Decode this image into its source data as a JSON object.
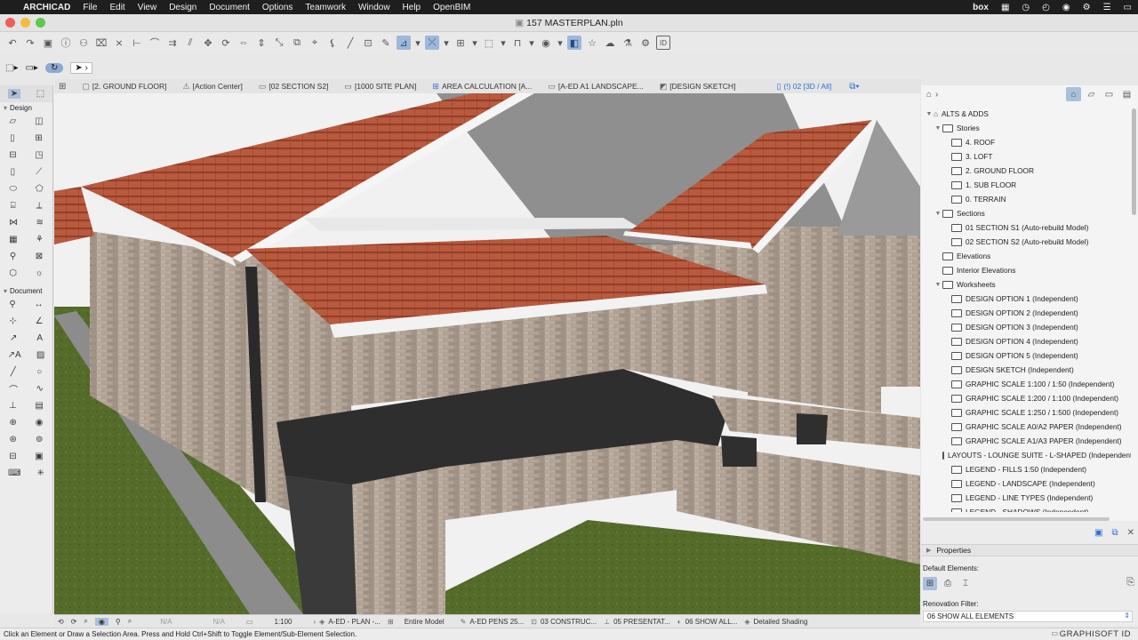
{
  "menubar": {
    "app": "ARCHICAD",
    "items": [
      "File",
      "Edit",
      "View",
      "Design",
      "Document",
      "Options",
      "Teamwork",
      "Window",
      "Help",
      "OpenBIM"
    ],
    "box_label": "box"
  },
  "window": {
    "title": "157 MASTERPLAN.pln"
  },
  "tabs": [
    {
      "label": "[2. GROUND FLOOR]",
      "icon": "floorplan-icon",
      "active": false
    },
    {
      "label": "[Action Center]",
      "icon": "action-center-icon",
      "active": false
    },
    {
      "label": "[02 SECTION S2]",
      "icon": "section-icon",
      "active": false
    },
    {
      "label": "[1000 SITE PLAN]",
      "icon": "layout-icon",
      "active": false
    },
    {
      "label": "AREA CALCULATION [A...",
      "icon": "schedule-icon",
      "active": false
    },
    {
      "label": "[A-ED A1 LANDSCAPE...",
      "icon": "layout-icon",
      "active": false
    },
    {
      "label": "[DESIGN SKETCH]",
      "icon": "worksheet-icon",
      "active": false
    },
    {
      "label": "(!) 02 [3D / All]",
      "icon": "3d-icon",
      "active": true
    }
  ],
  "toolbox": {
    "design_label": "Design",
    "document_label": "Document"
  },
  "navigator": {
    "root": "ALTS & ADDS",
    "items": [
      {
        "level": 1,
        "arrow": "v",
        "label": "Stories",
        "icon": "folder"
      },
      {
        "level": 2,
        "arrow": "",
        "label": "4. ROOF",
        "icon": "story"
      },
      {
        "level": 2,
        "arrow": "",
        "label": "3. LOFT",
        "icon": "story"
      },
      {
        "level": 2,
        "arrow": "",
        "label": "2. GROUND FLOOR",
        "icon": "story"
      },
      {
        "level": 2,
        "arrow": "",
        "label": "1. SUB FLOOR",
        "icon": "story"
      },
      {
        "level": 2,
        "arrow": "",
        "label": "0. TERRAIN",
        "icon": "story"
      },
      {
        "level": 1,
        "arrow": "v",
        "label": "Sections",
        "icon": "folder"
      },
      {
        "level": 2,
        "arrow": "",
        "label": "01 SECTION S1 (Auto-rebuild Model)",
        "icon": "section"
      },
      {
        "level": 2,
        "arrow": "",
        "label": "02 SECTION S2 (Auto-rebuild Model)",
        "icon": "section"
      },
      {
        "level": 1,
        "arrow": "",
        "label": "Elevations",
        "icon": "folder"
      },
      {
        "level": 1,
        "arrow": "",
        "label": "Interior Elevations",
        "icon": "folder"
      },
      {
        "level": 1,
        "arrow": "v",
        "label": "Worksheets",
        "icon": "folder"
      },
      {
        "level": 2,
        "arrow": "",
        "label": "DESIGN OPTION 1 (Independent)",
        "icon": "worksheet"
      },
      {
        "level": 2,
        "arrow": "",
        "label": "DESIGN OPTION 2 (Independent)",
        "icon": "worksheet"
      },
      {
        "level": 2,
        "arrow": "",
        "label": "DESIGN OPTION 3 (Independent)",
        "icon": "worksheet"
      },
      {
        "level": 2,
        "arrow": "",
        "label": "DESIGN OPTION 4 (Independent)",
        "icon": "worksheet"
      },
      {
        "level": 2,
        "arrow": "",
        "label": "DESIGN OPTION 5 (Independent)",
        "icon": "worksheet"
      },
      {
        "level": 2,
        "arrow": "",
        "label": "DESIGN SKETCH (Independent)",
        "icon": "worksheet"
      },
      {
        "level": 2,
        "arrow": "",
        "label": "GRAPHIC SCALE 1:100 / 1:50 (Independent)",
        "icon": "worksheet"
      },
      {
        "level": 2,
        "arrow": "",
        "label": "GRAPHIC SCALE 1:200 / 1:100 (Independent)",
        "icon": "worksheet"
      },
      {
        "level": 2,
        "arrow": "",
        "label": "GRAPHIC SCALE 1:250 / 1:500 (Independent)",
        "icon": "worksheet"
      },
      {
        "level": 2,
        "arrow": "",
        "label": "GRAPHIC SCALE A0/A2 PAPER (Independent)",
        "icon": "worksheet"
      },
      {
        "level": 2,
        "arrow": "",
        "label": "GRAPHIC SCALE A1/A3 PAPER (Independent)",
        "icon": "worksheet"
      },
      {
        "level": 2,
        "arrow": "",
        "label": "LAYOUTS - LOUNGE SUITE - L-SHAPED (Independent)",
        "icon": "worksheet"
      },
      {
        "level": 2,
        "arrow": "",
        "label": "LEGEND - FILLS 1:50 (Independent)",
        "icon": "worksheet"
      },
      {
        "level": 2,
        "arrow": "",
        "label": "LEGEND - LANDSCAPE  (Independent)",
        "icon": "worksheet"
      },
      {
        "level": 2,
        "arrow": "",
        "label": "LEGEND - LINE TYPES (Independent)",
        "icon": "worksheet"
      },
      {
        "level": 2,
        "arrow": "",
        "label": "LEGEND - SHADOWS (Independent)",
        "icon": "worksheet"
      }
    ]
  },
  "properties": {
    "label": "Properties",
    "default_elements": "Default Elements:",
    "renovation_filter_label": "Renovation Filter:",
    "renovation_filter_value": "06 SHOW ALL ELEMENTS"
  },
  "statusbar": {
    "na1": "N/A",
    "na2": "N/A",
    "scale": "1:100",
    "layer_combo": "A-ED - PLAN -...",
    "model": "Entire Model",
    "pens": "A-ED PENS 25...",
    "mvo": "03 CONSTRUC...",
    "dim": "05 PRESENTAT...",
    "reno": "06 SHOW ALL...",
    "shading": "Detailed Shading"
  },
  "message": "Click an Element or Draw a Selection Area. Press and Hold Ctrl+Shift to Toggle Element/Sub-Element Selection.",
  "brand": "GRAPHISOFT ID"
}
